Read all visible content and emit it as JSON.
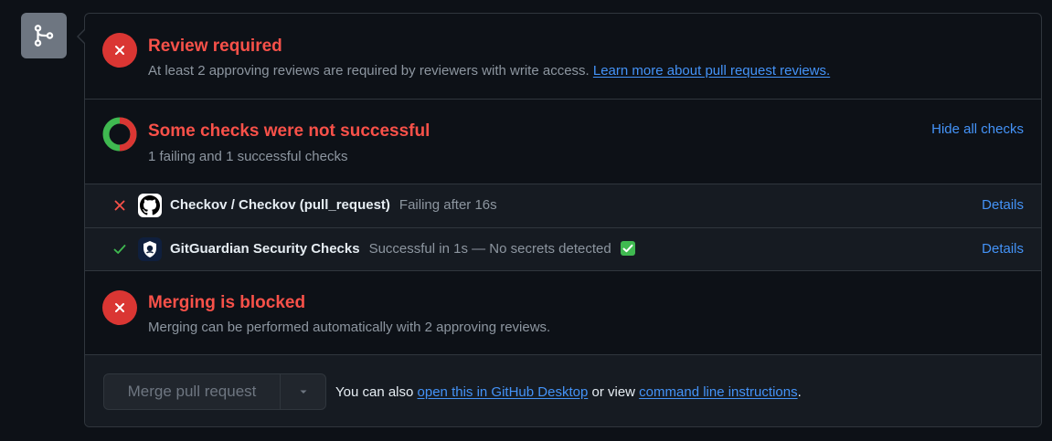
{
  "review": {
    "title": "Review required",
    "subtitle": "At least 2 approving reviews are required by reviewers with write access.",
    "link": "Learn more about pull request reviews."
  },
  "checks": {
    "title": "Some checks were not successful",
    "subtitle": "1 failing and 1 successful checks",
    "toggle_label": "Hide all checks",
    "items": [
      {
        "status": "failure",
        "status_icon": "x-icon",
        "avatar_icon": "github-logo-icon",
        "name": "Checkov / Checkov (pull_request)",
        "description": "Failing after 16s",
        "details_label": "Details"
      },
      {
        "status": "success",
        "status_icon": "check-icon",
        "avatar_icon": "gitguardian-logo-icon",
        "name": "GitGuardian Security Checks",
        "description": "Successful in 1s — No secrets detected",
        "details_label": "Details"
      }
    ]
  },
  "merging": {
    "title": "Merging is blocked",
    "subtitle": "Merging can be performed automatically with 2 approving reviews."
  },
  "footer": {
    "merge_button_label": "Merge pull request",
    "text_prefix": "You can also",
    "desktop_link": "open this in GitHub Desktop",
    "text_middle": "or view",
    "cli_link": "command line instructions",
    "text_suffix": "."
  },
  "colors": {
    "danger": "#f85149",
    "danger_bg": "#da3633",
    "success": "#3fb950",
    "link": "#4493f8",
    "muted": "#8d96a0"
  }
}
